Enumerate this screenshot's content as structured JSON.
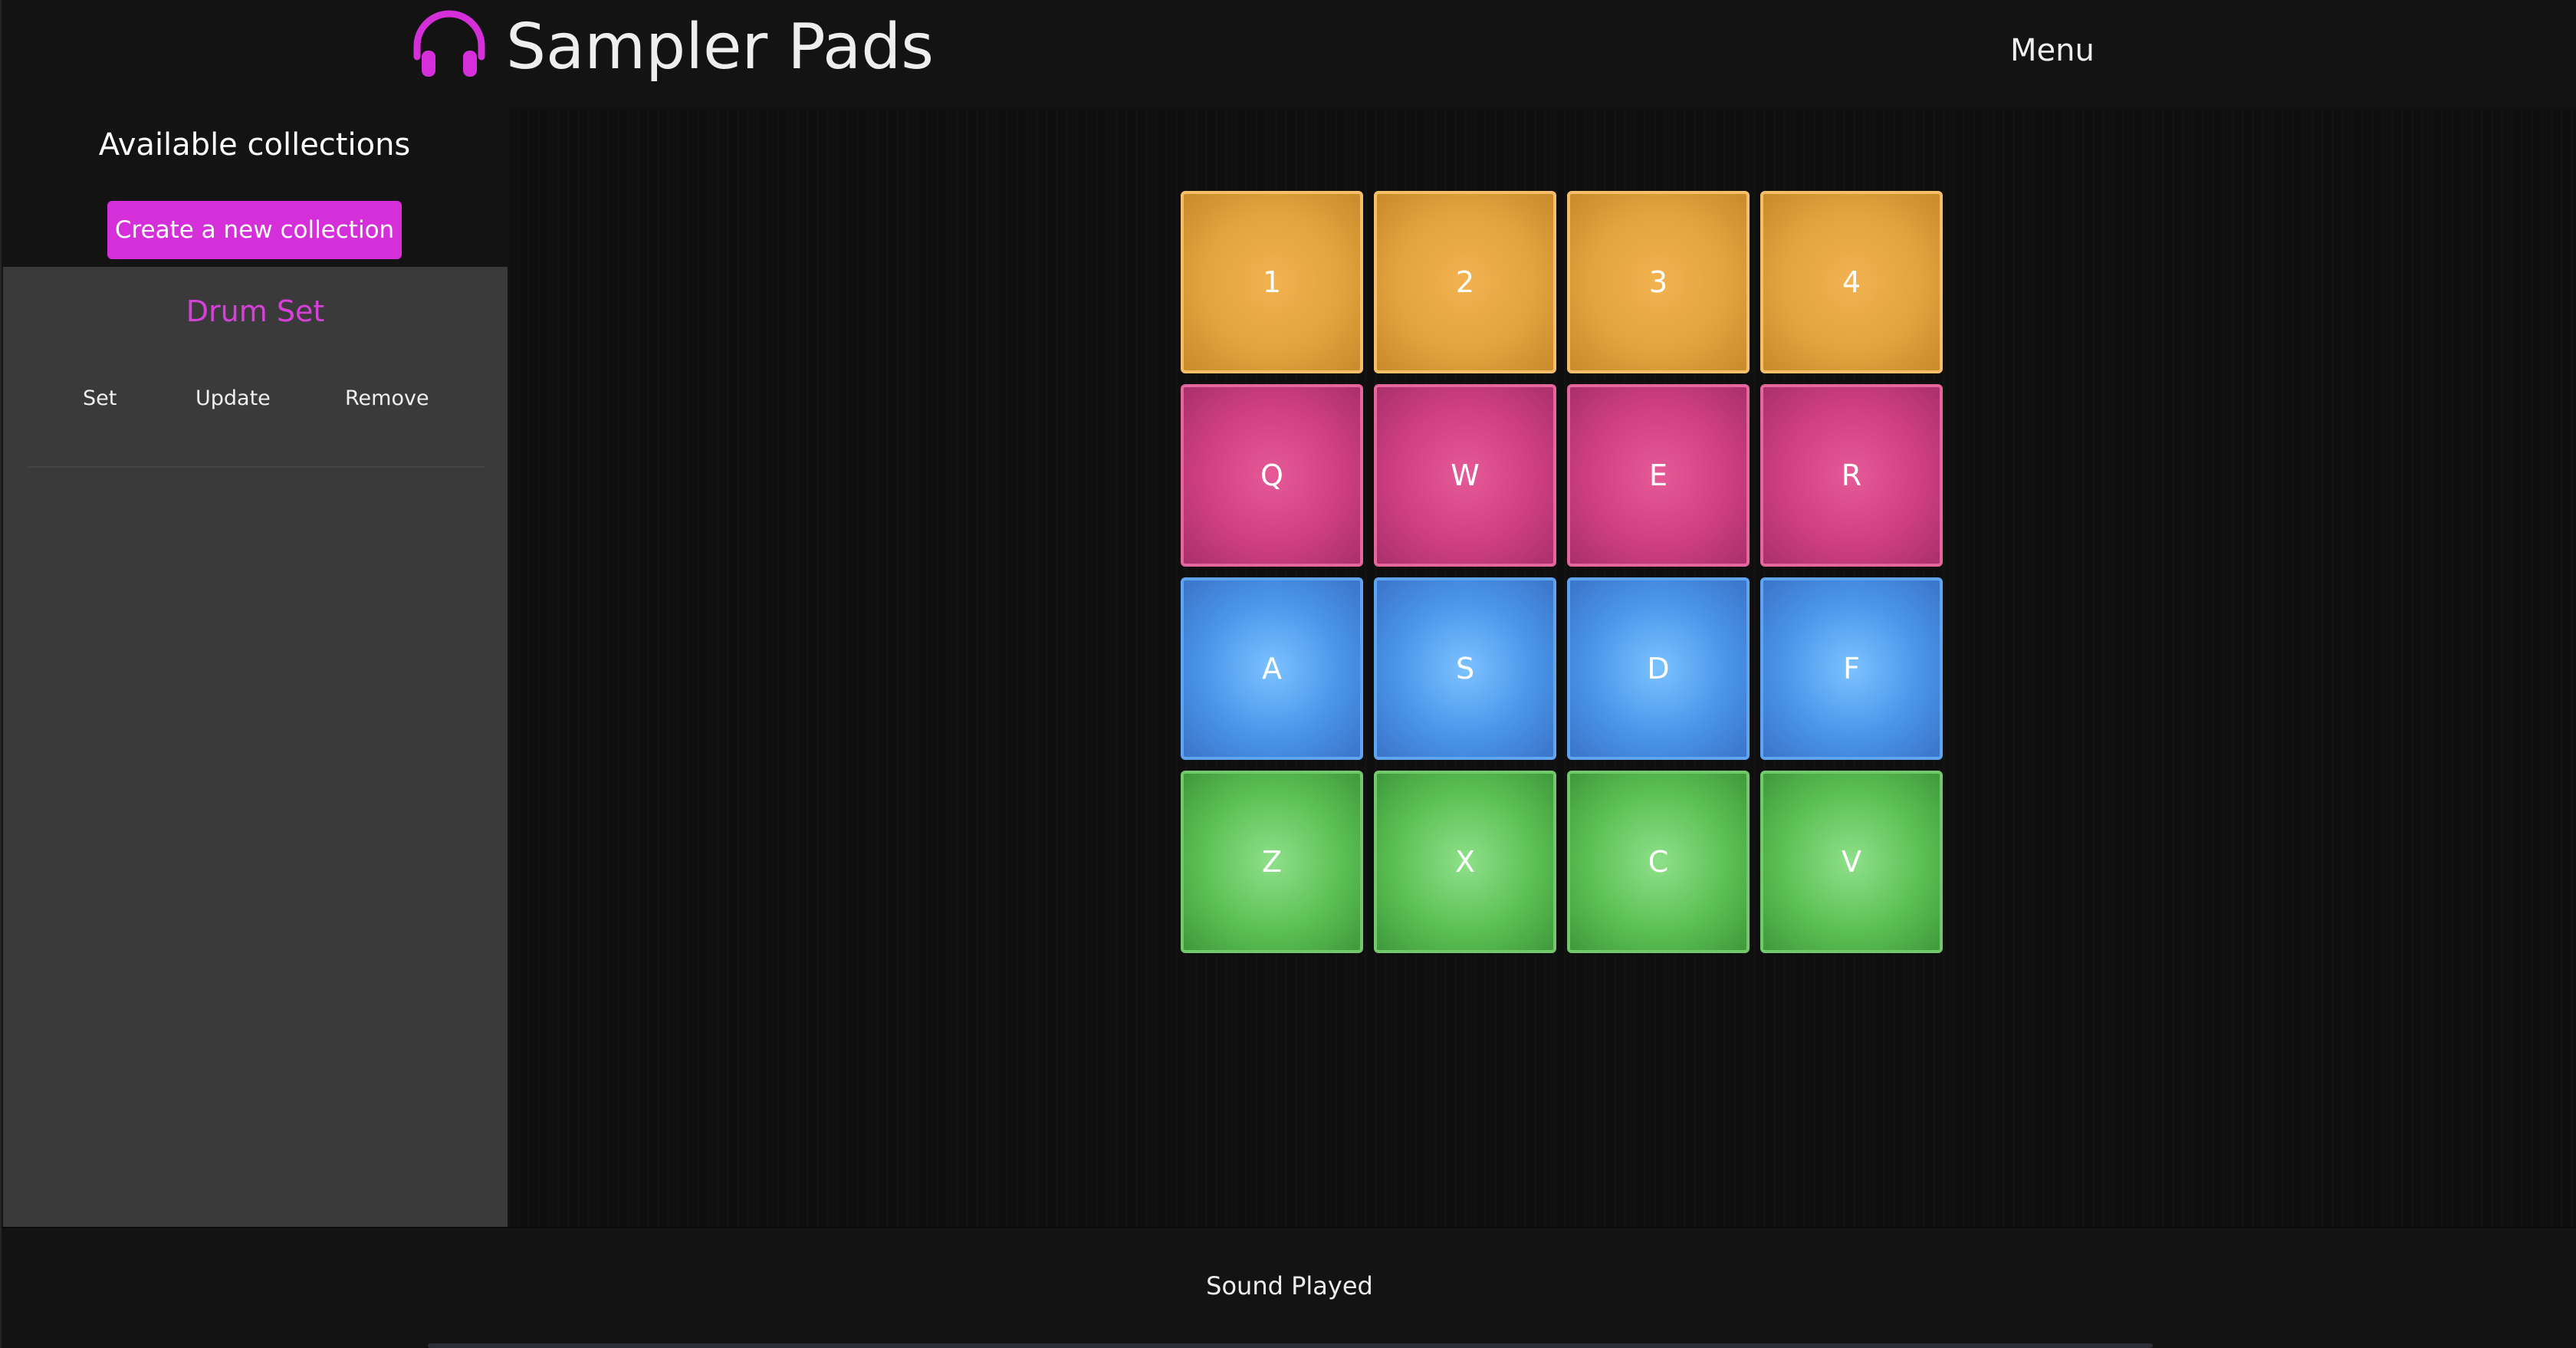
{
  "header": {
    "title": "Sampler Pads",
    "menu_label": "Menu",
    "logo_icon": "headphones-icon",
    "brand_color": "#d42fd9"
  },
  "sidebar": {
    "title": "Available collections",
    "create_button_label": "Create a new collection",
    "collections": [
      {
        "name": "Drum Set",
        "actions": {
          "set": "Set",
          "update": "Update",
          "remove": "Remove"
        }
      }
    ]
  },
  "pads": {
    "rows": [
      {
        "color": "orange",
        "color_hex": "#e1a43e",
        "keys": [
          "1",
          "2",
          "3",
          "4"
        ]
      },
      {
        "color": "pink",
        "color_hex": "#cf3f82",
        "keys": [
          "Q",
          "W",
          "E",
          "R"
        ]
      },
      {
        "color": "blue",
        "color_hex": "#4a95ea",
        "keys": [
          "A",
          "S",
          "D",
          "F"
        ]
      },
      {
        "color": "green",
        "color_hex": "#5cc155",
        "keys": [
          "Z",
          "X",
          "C",
          "V"
        ]
      }
    ]
  },
  "footer": {
    "status": "Sound Played"
  }
}
